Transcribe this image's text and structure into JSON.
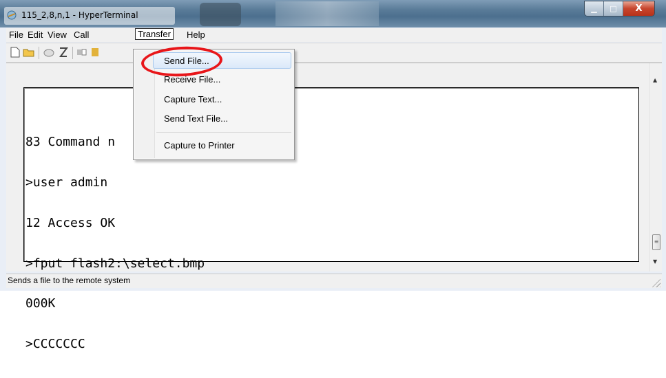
{
  "window": {
    "title": "115_2,8,n,1 - HyperTerminal",
    "caption_buttons": {
      "minimize": "▁",
      "maximize": "□",
      "close": "X"
    }
  },
  "menubar": {
    "items": [
      "File",
      "Edit",
      "View",
      "Call",
      "Transfer",
      "Help"
    ],
    "active": "Transfer"
  },
  "toolbar": {
    "icons": [
      "new-document-icon",
      "open-folder-icon",
      "connect-phone-icon",
      "disconnect-phone-icon",
      "send-icon",
      "receive-icon"
    ]
  },
  "transfer_menu": {
    "items": [
      "Send File...",
      "Receive File...",
      "Capture Text...",
      "Send Text File...",
      "Capture to Printer"
    ],
    "highlighted": "Send File..."
  },
  "terminal": {
    "lines": [
      "83 Command n",
      ">user admin",
      "12 Access OK",
      ">fput flash2:\\select.bmp",
      "000K",
      ">CCCCCCC"
    ]
  },
  "statusbar": {
    "text": "Sends a file to the remote system"
  },
  "colors": {
    "annotation_ring": "#e8161a",
    "menu_highlight": "#dbe9f9"
  }
}
